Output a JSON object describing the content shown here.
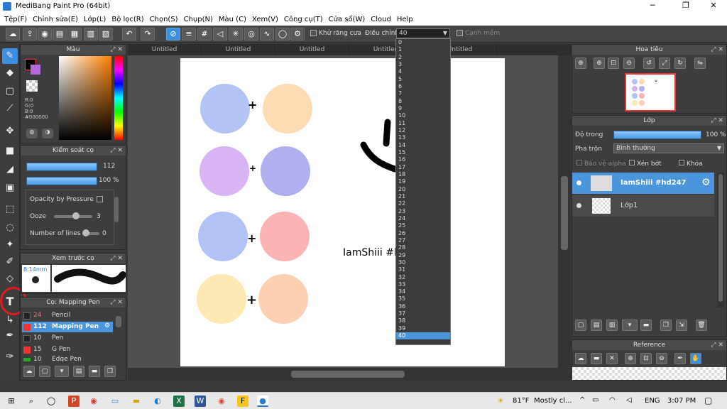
{
  "window": {
    "title": "MediBang Paint Pro (64bit)"
  },
  "menu": [
    "Tệp(F)",
    "Chỉnh sửa(E)",
    "Lớp(L)",
    "Bộ lọc(R)",
    "Chọn(S)",
    "Chụp(N)",
    "Màu (C)",
    "Xem(V)",
    "Công cụ(T)",
    "Cửa sổ(W)",
    "Cloud",
    "Help"
  ],
  "toolbar": {
    "antialias_label": "Khử răng cưa",
    "adjust_label": "Điều chỉnh",
    "zoom_value": "40",
    "smooth_label": "Cạnh mềm"
  },
  "tabs": [
    "Untitled",
    "Untitled",
    "Untitled",
    "Untitled",
    "Untitled"
  ],
  "color_panel": {
    "title": "Màu",
    "r": "R:0",
    "g": "G:0",
    "b": "B:0",
    "hex": "#000000"
  },
  "brush_control": {
    "title": "Kiểm soát cọ",
    "size": "112",
    "opacity": "100 %",
    "opacity_pressure": "Opacity by Pressure",
    "ooze_label": "Ooze",
    "ooze_value": "3",
    "lines_label": "Number of lines",
    "lines_value": "0"
  },
  "brush_preview": {
    "title": "Xem trước cọ",
    "size": "8.14mm"
  },
  "brush_list": {
    "title": "Cọ: Mapping Pen",
    "items": [
      {
        "size": "24",
        "name": "Pencil"
      },
      {
        "size": "112",
        "name": "Mapping Pen"
      },
      {
        "size": "10",
        "name": "Pen"
      },
      {
        "size": "15",
        "name": "G Pen"
      },
      {
        "size": "10",
        "name": "Edge Pen"
      }
    ]
  },
  "canvas_text": "IamShiii #h",
  "zoom_options": [
    "0",
    "1",
    "2",
    "3",
    "4",
    "5",
    "6",
    "7",
    "8",
    "9",
    "10",
    "11",
    "12",
    "13",
    "14",
    "15",
    "16",
    "17",
    "18",
    "19",
    "20",
    "21",
    "22",
    "23",
    "24",
    "25",
    "26",
    "27",
    "28",
    "29",
    "30",
    "31",
    "32",
    "33",
    "34",
    "35",
    "36",
    "37",
    "38",
    "39",
    "40"
  ],
  "navigator": {
    "title": "Hoa tiêu"
  },
  "layers": {
    "title": "Lớp",
    "opacity_label": "Độ trong",
    "opacity_value": "100 %",
    "blend_label": "Pha trộn",
    "blend_value": "Bình thường",
    "protect_alpha": "Bảo vệ alpha",
    "clip": "Xén bớt",
    "lock": "Khóa",
    "items": [
      {
        "name": "IamShiii #hd247"
      },
      {
        "name": "Lớp1"
      }
    ]
  },
  "reference": {
    "title": "Reference"
  },
  "taskbar": {
    "temp": "81°F",
    "weather": "Mostly cl...",
    "lang": "ENG",
    "time": "3:07 PM"
  },
  "colors": {
    "accent": "#4b95dc",
    "circles": [
      "#b3c3f5",
      "#fddcb3",
      "#d9b4f5",
      "#b0b0f0",
      "#b3c3f5",
      "#fcb3b3",
      "#fde9b3",
      "#fdcfb3"
    ]
  }
}
